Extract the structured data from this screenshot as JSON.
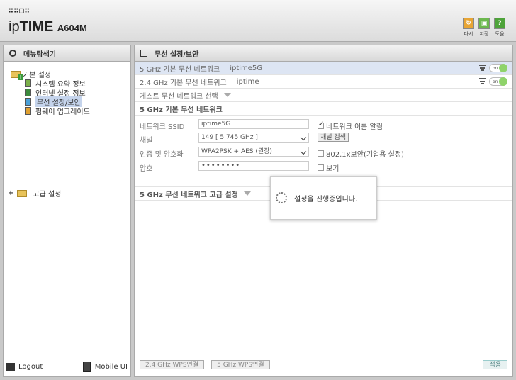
{
  "header": {
    "brand_dots": "∷∷□∷",
    "brand_ip": "ip",
    "brand_time": "TIME",
    "brand_model": "A604M",
    "buttons": [
      {
        "label": "다시",
        "icon": "refresh-icon",
        "color": "#e8a534"
      },
      {
        "label": "저장",
        "icon": "save-icon",
        "color": "#6cb84e"
      },
      {
        "label": "도움",
        "icon": "help-icon",
        "color": "#4ea33a"
      }
    ]
  },
  "sidebar": {
    "title": "메뉴탐색기",
    "group_basic": "기본 설정",
    "items": [
      {
        "label": "시스템 요약 정보",
        "icon": "system-summary-icon"
      },
      {
        "label": "인터넷 설정 정보",
        "icon": "internet-settings-icon"
      },
      {
        "label": "무선 설정/보안",
        "icon": "wireless-settings-icon",
        "selected": true
      },
      {
        "label": "펌웨어 업그레이드",
        "icon": "firmware-icon"
      }
    ],
    "group_advanced": "고급 설정",
    "logout": "Logout",
    "mobile": "Mobile UI"
  },
  "main": {
    "title": "무선 설정/보안",
    "networks": [
      {
        "band": "5 GHz 기본 무선 네트워크",
        "ssid": "iptime5G",
        "toggle": "on"
      },
      {
        "band": "2.4 GHz 기본 무선 네트워크",
        "ssid": "iptime",
        "toggle": "on"
      }
    ],
    "guest_select": "게스트 무선 네트워크 선택",
    "section_5g": "5 GHz 기본 무선 네트워크",
    "form": {
      "ssid_label": "네트워크 SSID",
      "ssid_value": "iptime5G",
      "broadcast_label": "네트워크 이름 알림",
      "channel_label": "채널",
      "channel_value": "149 [ 5.745 GHz ]",
      "channel_search": "채널 검색",
      "auth_label": "인증 및 암호화",
      "auth_value": "WPA2PSK + AES (권장)",
      "enterprise_label": "802.1x보안(기업용 설정)",
      "password_label": "암호",
      "password_value": "••••••••",
      "show_label": "보기"
    },
    "advanced": "5 GHz 무선 네트워크 고급 설정",
    "toast": "설정을 진행중입니다.",
    "wps_24": "2.4 GHz WPS연결",
    "wps_5": "5 GHz WPS연결",
    "apply": "적용"
  }
}
